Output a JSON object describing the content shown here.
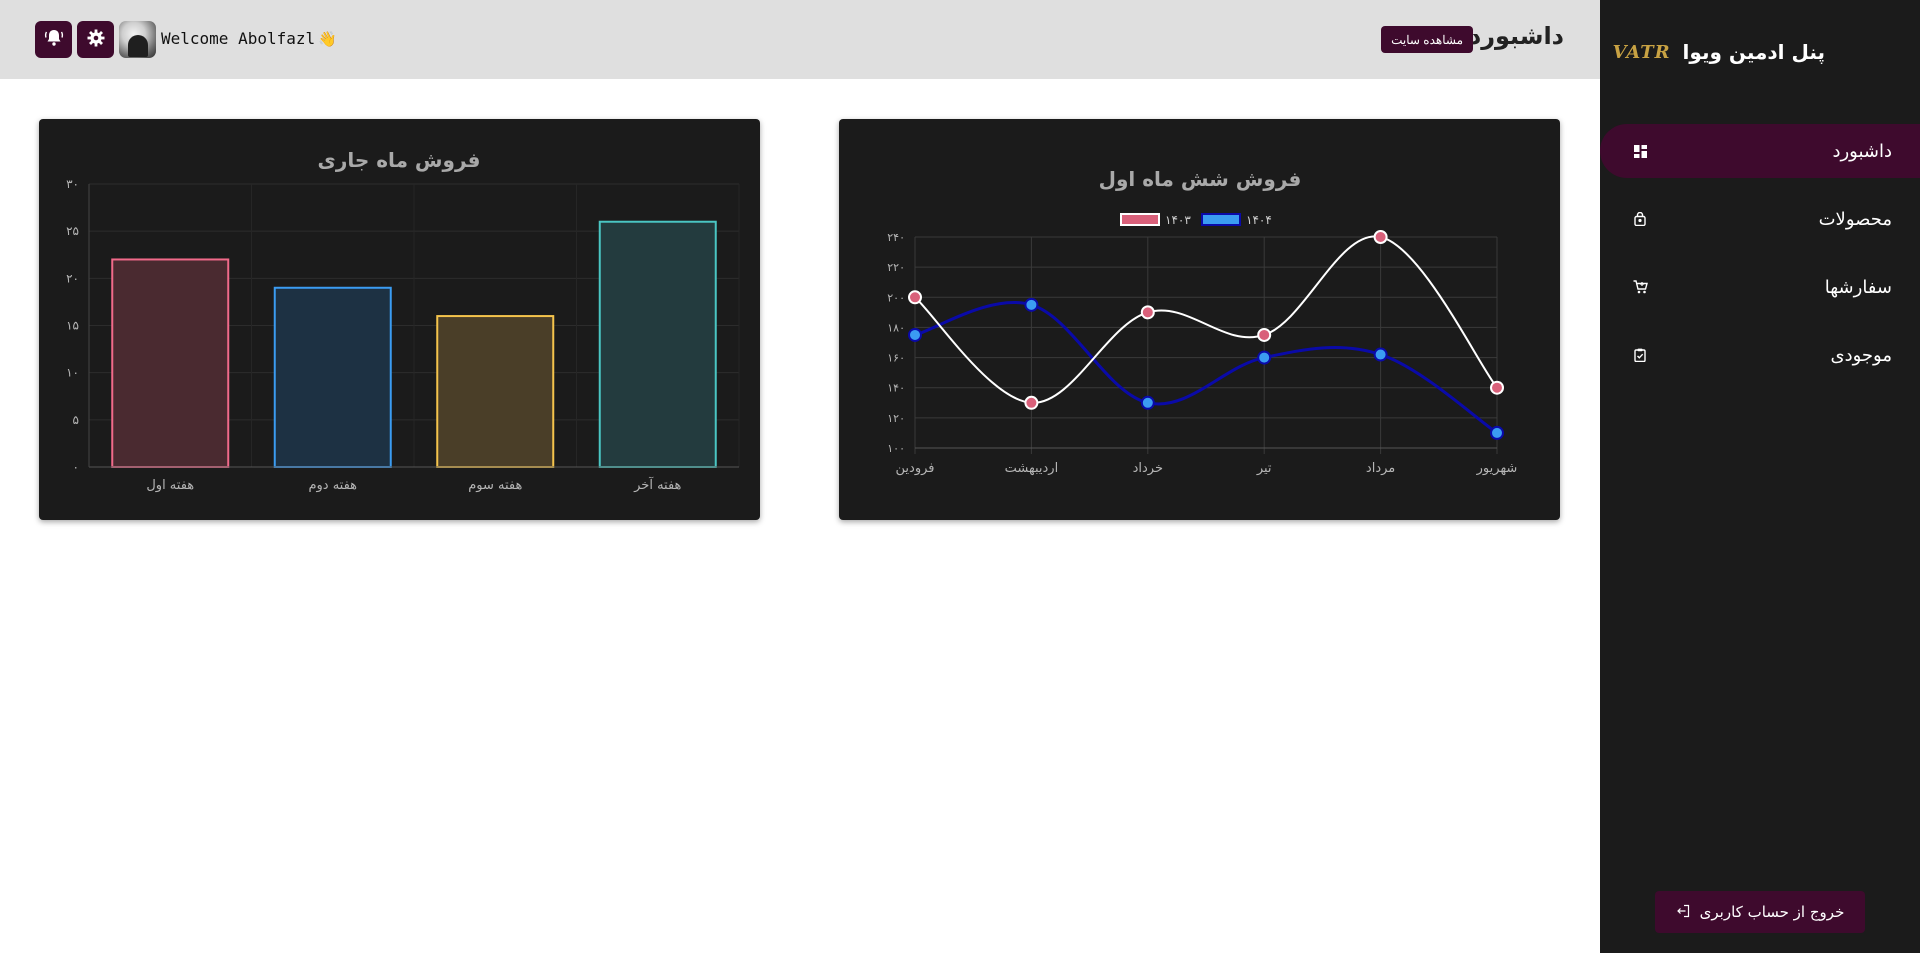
{
  "sidebar": {
    "brand_title": "پنل ادمین ویوا",
    "brand_logo": "VATR",
    "items": [
      {
        "label": "داشبورد",
        "icon": "dashboard-icon",
        "active": true
      },
      {
        "label": "محصولات",
        "icon": "bag-icon",
        "active": false
      },
      {
        "label": "سفارشها",
        "icon": "cart-icon",
        "active": false
      },
      {
        "label": "موجودی",
        "icon": "clipboard-check-icon",
        "active": false
      }
    ],
    "logout_label": "خروج از حساب کاربری"
  },
  "header": {
    "page_title": "داشبورد",
    "view_site_label": "مشاهده سایت",
    "welcome_text": "Welcome Abolfazl",
    "wave_emoji": "👋"
  },
  "colors": {
    "sidebar_bg": "#1b1b1b",
    "accent": "#3e0a2d",
    "header_bg": "#dfdfdf",
    "card_bg": "#1b1b1b"
  },
  "chart_data": [
    {
      "type": "bar",
      "title": "فروش ماه جاری",
      "categories": [
        "هفته اول",
        "هفته دوم",
        "هفته سوم",
        "هفته آخر"
      ],
      "values": [
        22,
        19,
        16,
        26
      ],
      "ylim": [
        0,
        30
      ],
      "yticks": [
        "۰",
        "۵",
        "۱۰",
        "۱۵",
        "۲۰",
        "۲۵",
        "۳۰"
      ],
      "bar_fill": [
        "#4a2a30",
        "#1d3143",
        "#4a3e28",
        "#233b3e"
      ],
      "bar_stroke": [
        "#f16a8a",
        "#3b9cf2",
        "#f5c44c",
        "#4ac6c3"
      ],
      "grid": true
    },
    {
      "type": "line",
      "title": "فروش شش ماه اول",
      "categories": [
        "فرودین",
        "اردیبهشت",
        "خرداد",
        "تیر",
        "مرداد",
        "شهریور"
      ],
      "ylim": [
        100,
        240
      ],
      "yticks": [
        "۱۰۰",
        "۱۲۰",
        "۱۴۰",
        "۱۶۰",
        "۱۸۰",
        "۲۰۰",
        "۲۲۰",
        "۲۴۰"
      ],
      "series": [
        {
          "name": "۱۴۰۳",
          "values": [
            200,
            130,
            190,
            175,
            240,
            140
          ],
          "line_color": "#ffffff",
          "point_color": "#d9607a",
          "legend_fill": "#d9607a",
          "legend_stroke": "#ffffff"
        },
        {
          "name": "۱۴۰۴",
          "values": [
            175,
            195,
            130,
            160,
            162,
            110
          ],
          "line_color": "#0a0aa8",
          "point_color": "#3b9cf2",
          "legend_fill": "#3b9cf2",
          "legend_stroke": "#0a0aa8"
        }
      ],
      "legend": "top-center",
      "grid": true
    }
  ]
}
